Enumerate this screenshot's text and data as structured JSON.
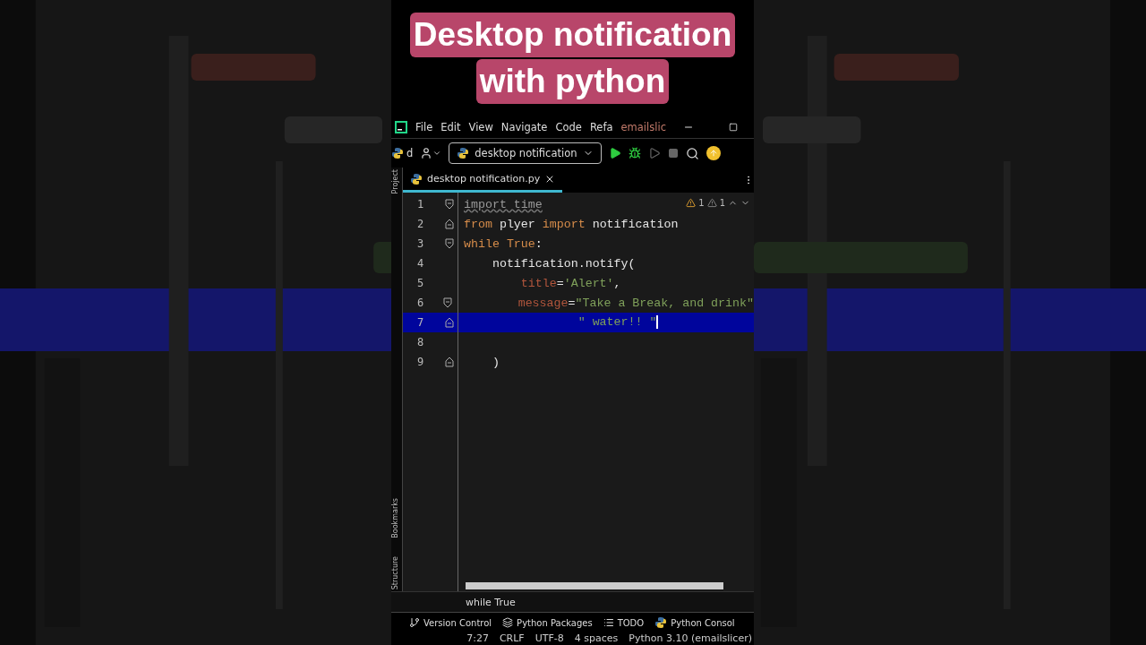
{
  "title_overlay": {
    "lines": [
      "Desktop notification",
      "with python"
    ]
  },
  "menu_bar": {
    "items": [
      "File",
      "Edit",
      "View",
      "Navigate",
      "Code",
      "Refa"
    ],
    "project": "emailslic"
  },
  "toolbar": {
    "project_label": "d",
    "run_config": "desktop notification"
  },
  "side_tabs": {
    "top": [
      "Project"
    ],
    "bottom": [
      "Bookmarks",
      "Structure"
    ]
  },
  "editor_tab": {
    "label": "desktop notification.py",
    "selected": true
  },
  "inspections": {
    "warnings": "1",
    "weak_warnings": "1"
  },
  "code_lines": [
    {
      "number": "1",
      "fold_start": true,
      "fold_end": false,
      "selected": false,
      "tokens": [
        {
          "text": "import time",
          "kind": "unused"
        }
      ]
    },
    {
      "number": "2",
      "fold_start": false,
      "fold_end": true,
      "selected": false,
      "tokens": [
        {
          "text": "from",
          "kind": "kw"
        },
        {
          "text": " plyer ",
          "kind": "plain"
        },
        {
          "text": "import",
          "kind": "kw"
        },
        {
          "text": " notification",
          "kind": "plain"
        }
      ]
    },
    {
      "number": "3",
      "fold_start": true,
      "fold_end": false,
      "selected": false,
      "tokens": [
        {
          "text": "while",
          "kind": "kw"
        },
        {
          "text": " True",
          "kind": "kw"
        },
        {
          "text": ":",
          "kind": "plain"
        }
      ]
    },
    {
      "number": "4",
      "fold_start": false,
      "fold_end": false,
      "selected": false,
      "tokens": [
        {
          "text": "    notification.notify(",
          "kind": "plain"
        }
      ]
    },
    {
      "number": "5",
      "fold_start": false,
      "fold_end": false,
      "selected": false,
      "tokens": [
        {
          "text": "        title",
          "kind": "param"
        },
        {
          "text": "=",
          "kind": "plain"
        },
        {
          "text": "'Alert'",
          "kind": "str"
        },
        {
          "text": ",",
          "kind": "plain"
        }
      ]
    },
    {
      "number": "6",
      "fold_start": true,
      "fold_end": false,
      "selected": false,
      "tokens": [
        {
          "text": "        message",
          "kind": "param"
        },
        {
          "text": "=",
          "kind": "plain"
        },
        {
          "text": "\"Take a Break, and drink\"",
          "kind": "str"
        }
      ]
    },
    {
      "number": "7",
      "fold_start": false,
      "fold_end": true,
      "selected": true,
      "tokens": [
        {
          "text": "                \" water!! \"",
          "kind": "str"
        }
      ]
    },
    {
      "number": "8",
      "fold_start": false,
      "fold_end": false,
      "selected": false
    },
    {
      "number": "9",
      "fold_start": false,
      "fold_end": true,
      "selected": false,
      "tokens": [
        {
          "text": "    )",
          "kind": "plain"
        }
      ]
    }
  ],
  "breadcrumb": "while True",
  "tool_windows": [
    {
      "label": "Version Control",
      "kind": "vcs"
    },
    {
      "label": "Python Packages",
      "kind": "packages"
    },
    {
      "label": "TODO",
      "kind": "todo"
    },
    {
      "label": "Python Consol",
      "kind": "console"
    }
  ],
  "status_bar": [
    "7:27",
    "CRLF",
    "UTF-8",
    "4 spaces",
    "Python 3.10 (emailslicer)"
  ]
}
